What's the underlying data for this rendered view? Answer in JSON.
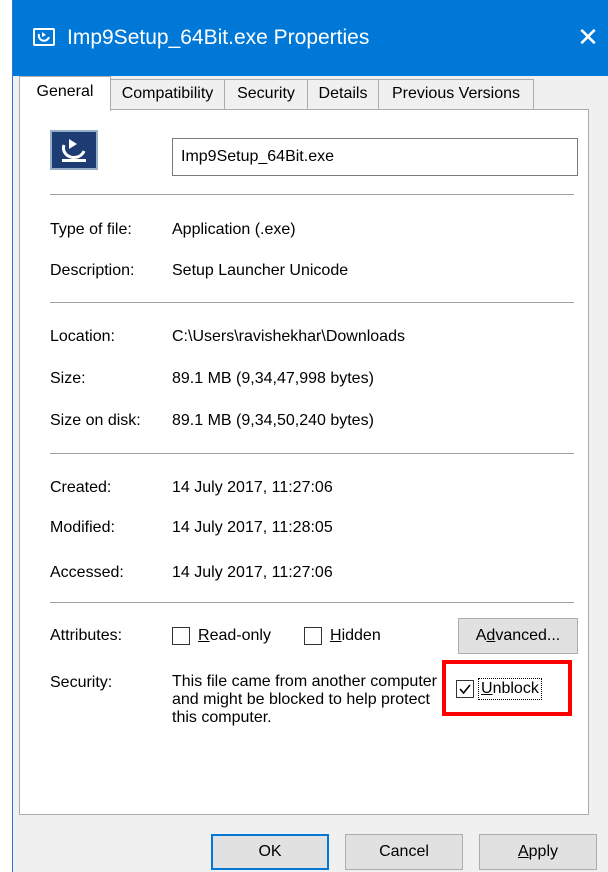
{
  "window": {
    "title": "Imp9Setup_64Bit.exe Properties",
    "close_glyph": "✕"
  },
  "tabs": [
    {
      "label": "General",
      "active": true
    },
    {
      "label": "Compatibility",
      "active": false
    },
    {
      "label": "Security",
      "active": false
    },
    {
      "label": "Details",
      "active": false
    },
    {
      "label": "Previous Versions",
      "active": false
    }
  ],
  "general": {
    "file_name": "Imp9Setup_64Bit.exe",
    "type_label": "Type of file:",
    "type_value": "Application (.exe)",
    "description_label": "Description:",
    "description_value": "Setup Launcher Unicode",
    "location_label": "Location:",
    "location_value": "C:\\Users\\ravishekhar\\Downloads",
    "size_label": "Size:",
    "size_value": "89.1 MB (9,34,47,998 bytes)",
    "size_on_disk_label": "Size on disk:",
    "size_on_disk_value": "89.1 MB (9,34,50,240 bytes)",
    "created_label": "Created:",
    "created_value": "14 July 2017, 11:27:06",
    "modified_label": "Modified:",
    "modified_value": "14 July 2017, 11:28:05",
    "accessed_label": "Accessed:",
    "accessed_value": "14 July 2017, 11:27:06",
    "attributes_label": "Attributes:",
    "readonly_first": "R",
    "readonly_rest": "ead-only",
    "readonly_checked": false,
    "hidden_first": "H",
    "hidden_rest": "idden",
    "hidden_checked": false,
    "advanced_pre": "A",
    "advanced_u": "d",
    "advanced_post": "vanced...",
    "security_label": "Security:",
    "security_text": "This file came from another computer and might be blocked to help protect this computer.",
    "unblock_first": "U",
    "unblock_rest": "nblock",
    "unblock_checked": true
  },
  "buttons": {
    "ok": "OK",
    "cancel": "Cancel",
    "apply_first": "A",
    "apply_rest": "pply"
  },
  "colors": {
    "titlebar": "#0078d7",
    "highlight": "#ff0000"
  }
}
